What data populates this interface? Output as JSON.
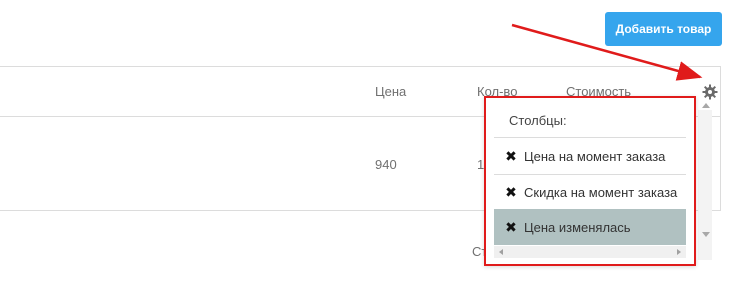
{
  "toolbar": {
    "add_product_label": "Добавить товар"
  },
  "table": {
    "columns": [
      "Цена",
      "Кол-во",
      "Стоимость"
    ],
    "row": {
      "price": "940",
      "qty_partial": "1"
    }
  },
  "footer": {
    "partial_label": "Сто"
  },
  "columns_menu": {
    "title": "Столбцы:",
    "items": [
      {
        "label": "Цена на момент заказа",
        "mark": "✖"
      },
      {
        "label": "Скидка на момент заказа",
        "mark": "✖"
      },
      {
        "label": "Цена изменялась",
        "mark": "✖"
      }
    ]
  },
  "colors": {
    "accent": "#35a5ed",
    "highlight": "#e01b1b",
    "hover": "#b0c1c1"
  },
  "icons": {
    "settings": "gear-icon",
    "remove": "close-icon"
  }
}
